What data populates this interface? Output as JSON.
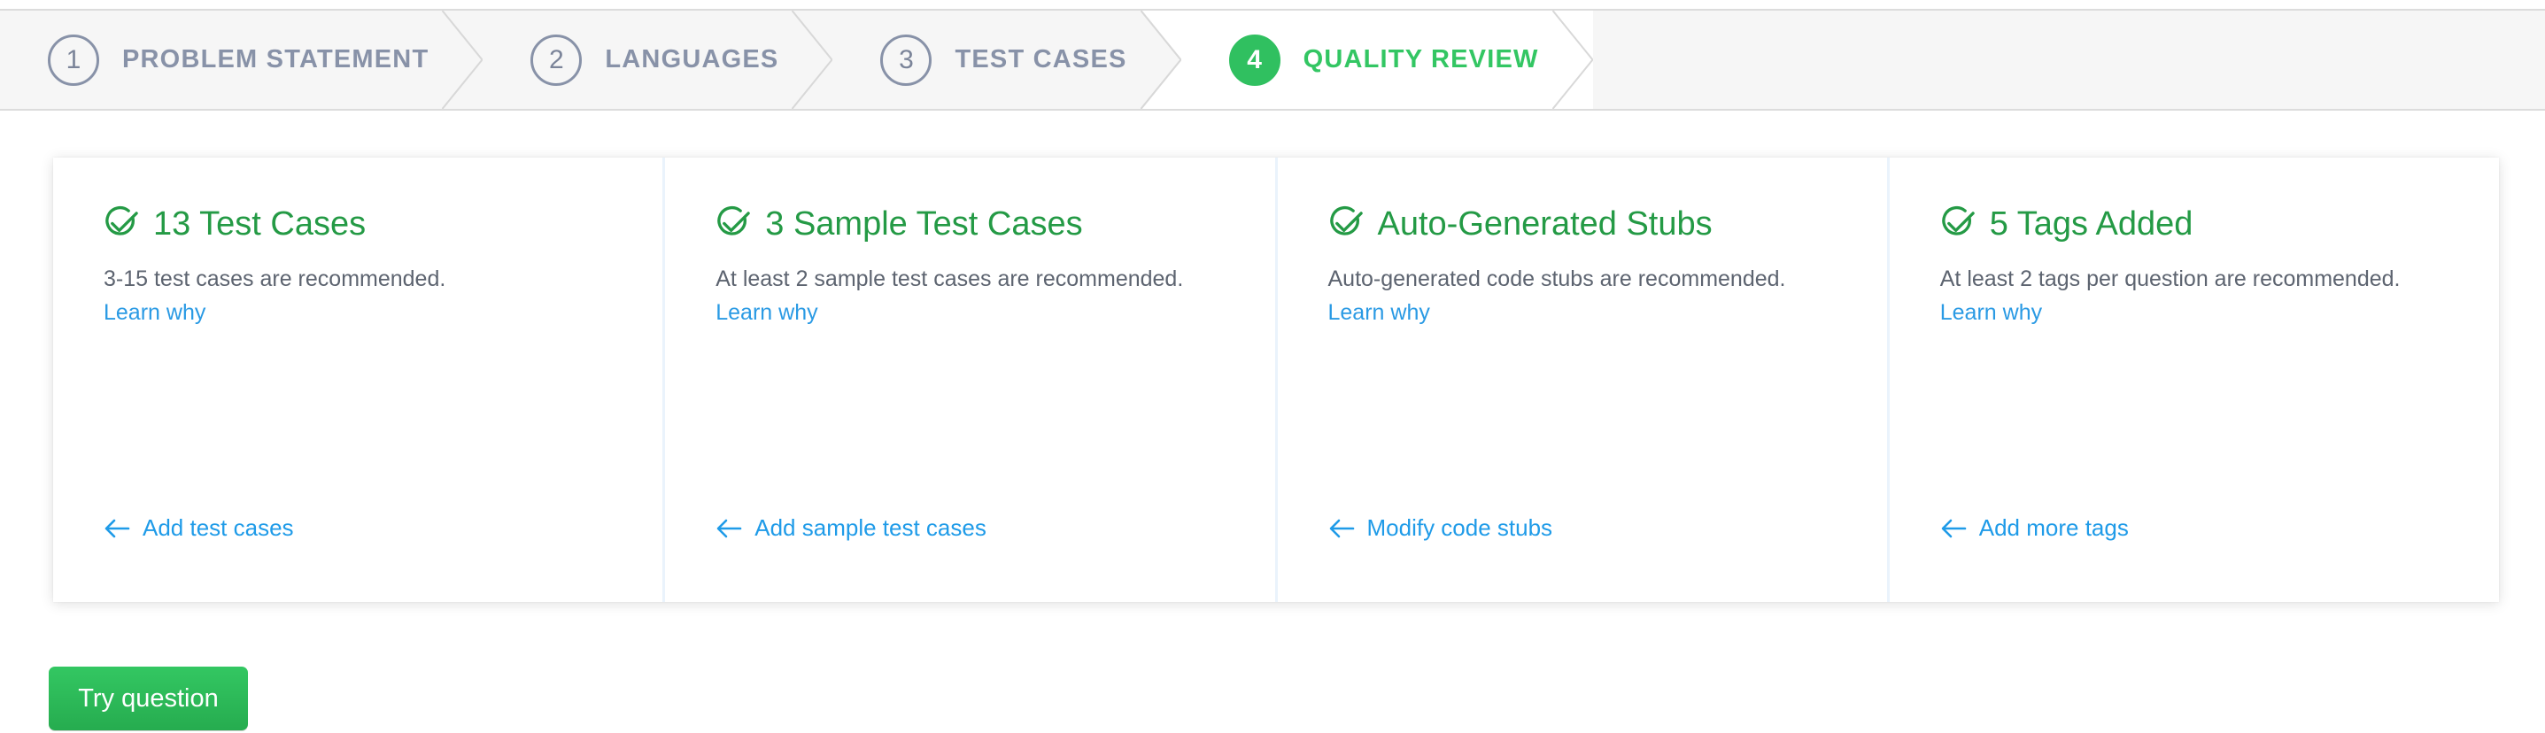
{
  "stepper": {
    "steps": [
      {
        "number": "1",
        "label": "PROBLEM STATEMENT",
        "state": "inactive"
      },
      {
        "number": "2",
        "label": "LANGUAGES",
        "state": "inactive"
      },
      {
        "number": "3",
        "label": "TEST CASES",
        "state": "inactive"
      },
      {
        "number": "4",
        "label": "QUALITY REVIEW",
        "state": "active"
      }
    ],
    "active_color": "#33c663",
    "inactive_color": "#8892a8",
    "active_badge_fill": "#30c060",
    "track_background": "#f6f6f6"
  },
  "quality_review": {
    "cards": [
      {
        "status_icon": "check-circle-icon",
        "title": "13 Test Cases",
        "description": "3-15 test cases are recommended.",
        "learn_link": "Learn why",
        "action_icon": "arrow-left-icon",
        "action_label": "Add test cases"
      },
      {
        "status_icon": "check-circle-icon",
        "title": "3 Sample Test Cases",
        "description": "At least 2 sample test cases are recommended.",
        "learn_link": "Learn why",
        "action_icon": "arrow-left-icon",
        "action_label": "Add sample test cases"
      },
      {
        "status_icon": "check-circle-icon",
        "title": "Auto-Generated Stubs",
        "description": "Auto-generated code stubs are recommended.",
        "learn_link": "Learn why",
        "action_icon": "arrow-left-icon",
        "action_label": "Modify code stubs"
      },
      {
        "status_icon": "check-circle-icon",
        "title": "5 Tags Added",
        "description": "At least 2 tags per question are recommended.",
        "learn_link": "Learn why",
        "action_icon": "arrow-left-icon",
        "action_label": "Add more tags"
      }
    ],
    "title_color": "#249a45",
    "link_color": "#2a9ae4",
    "description_color": "#5d6470",
    "divider_color": "#eaf3fc"
  },
  "footer": {
    "primary_button": "Try question",
    "primary_button_color": "#2bb757"
  }
}
